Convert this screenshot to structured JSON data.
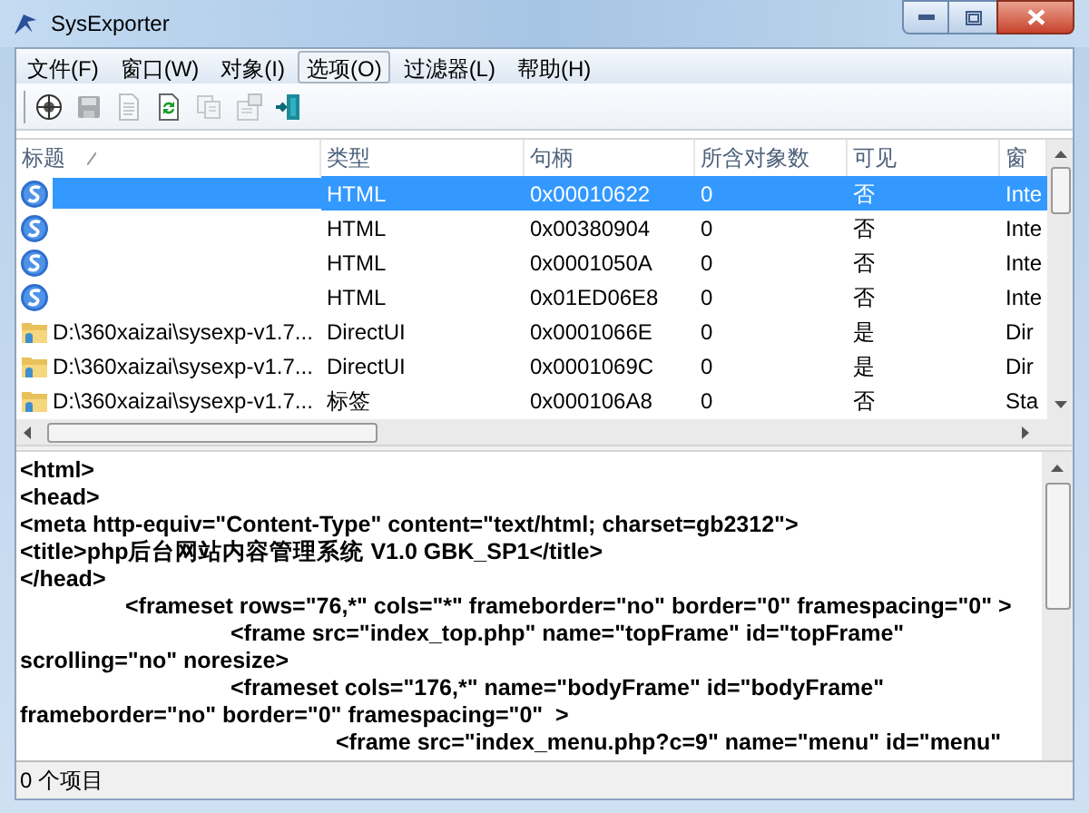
{
  "window": {
    "title": "SysExporter"
  },
  "menu": [
    {
      "label": "文件(F)",
      "selected": false
    },
    {
      "label": "窗口(W)",
      "selected": false
    },
    {
      "label": "对象(I)",
      "selected": false
    },
    {
      "label": "选项(O)",
      "selected": true
    },
    {
      "label": "过滤器(L)",
      "selected": false
    },
    {
      "label": "帮助(H)",
      "selected": false
    }
  ],
  "toolbar": [
    {
      "kind": "target",
      "disabled": false
    },
    {
      "kind": "save",
      "disabled": true
    },
    {
      "kind": "document",
      "disabled": true
    },
    {
      "kind": "refresh",
      "disabled": false
    },
    {
      "kind": "copy",
      "disabled": true
    },
    {
      "kind": "properties",
      "disabled": true
    },
    {
      "kind": "exit",
      "disabled": false
    }
  ],
  "table": {
    "columns": [
      "标题",
      "类型",
      "句柄",
      "所含对象数",
      "可见",
      "窗"
    ],
    "rows": [
      {
        "kind": "browser",
        "selected": true,
        "cells": [
          "",
          "HTML",
          "0x00010622",
          "0",
          "否",
          "Inte"
        ]
      },
      {
        "kind": "browser",
        "selected": false,
        "cells": [
          "",
          "HTML",
          "0x00380904",
          "0",
          "否",
          "Inte"
        ]
      },
      {
        "kind": "browser",
        "selected": false,
        "cells": [
          "",
          "HTML",
          "0x0001050A",
          "0",
          "否",
          "Inte"
        ]
      },
      {
        "kind": "browser",
        "selected": false,
        "cells": [
          "",
          "HTML",
          "0x01ED06E8",
          "0",
          "否",
          "Inte"
        ]
      },
      {
        "kind": "folder",
        "selected": false,
        "cells": [
          "D:\\360xaizai\\sysexp-v1.7...",
          "DirectUI",
          "0x0001066E",
          "0",
          "是",
          "Dir"
        ]
      },
      {
        "kind": "folder",
        "selected": false,
        "cells": [
          "D:\\360xaizai\\sysexp-v1.7...",
          "DirectUI",
          "0x0001069C",
          "0",
          "是",
          "Dir"
        ]
      },
      {
        "kind": "folder",
        "selected": false,
        "cells": [
          "D:\\360xaizai\\sysexp-v1.7...",
          "标签",
          "0x000106A8",
          "0",
          "否",
          "Sta"
        ]
      }
    ]
  },
  "code_lines": [
    "<html>",
    "<head>",
    "<meta http-equiv=\"Content-Type\" content=\"text/html; charset=gb2312\">",
    "<title>php后台网站内容管理系统 V1.0 GBK_SP1</title>",
    "</head>",
    "\t<frameset rows=\"76,*\" cols=\"*\" frameborder=\"no\" border=\"0\" framespacing=\"0\" >",
    "\t\t<frame src=\"index_top.php\" name=\"topFrame\" id=\"topFrame\" scrolling=\"no\" noresize>",
    "\t\t<frameset cols=\"176,*\" name=\"bodyFrame\" id=\"bodyFrame\" frameborder=\"no\" border=\"0\" framespacing=\"0\"  >",
    "\t\t\t<frame src=\"index_menu.php?c=9\" name=\"menu\" id=\"menu\""
  ],
  "status_bar": "0 个项目"
}
